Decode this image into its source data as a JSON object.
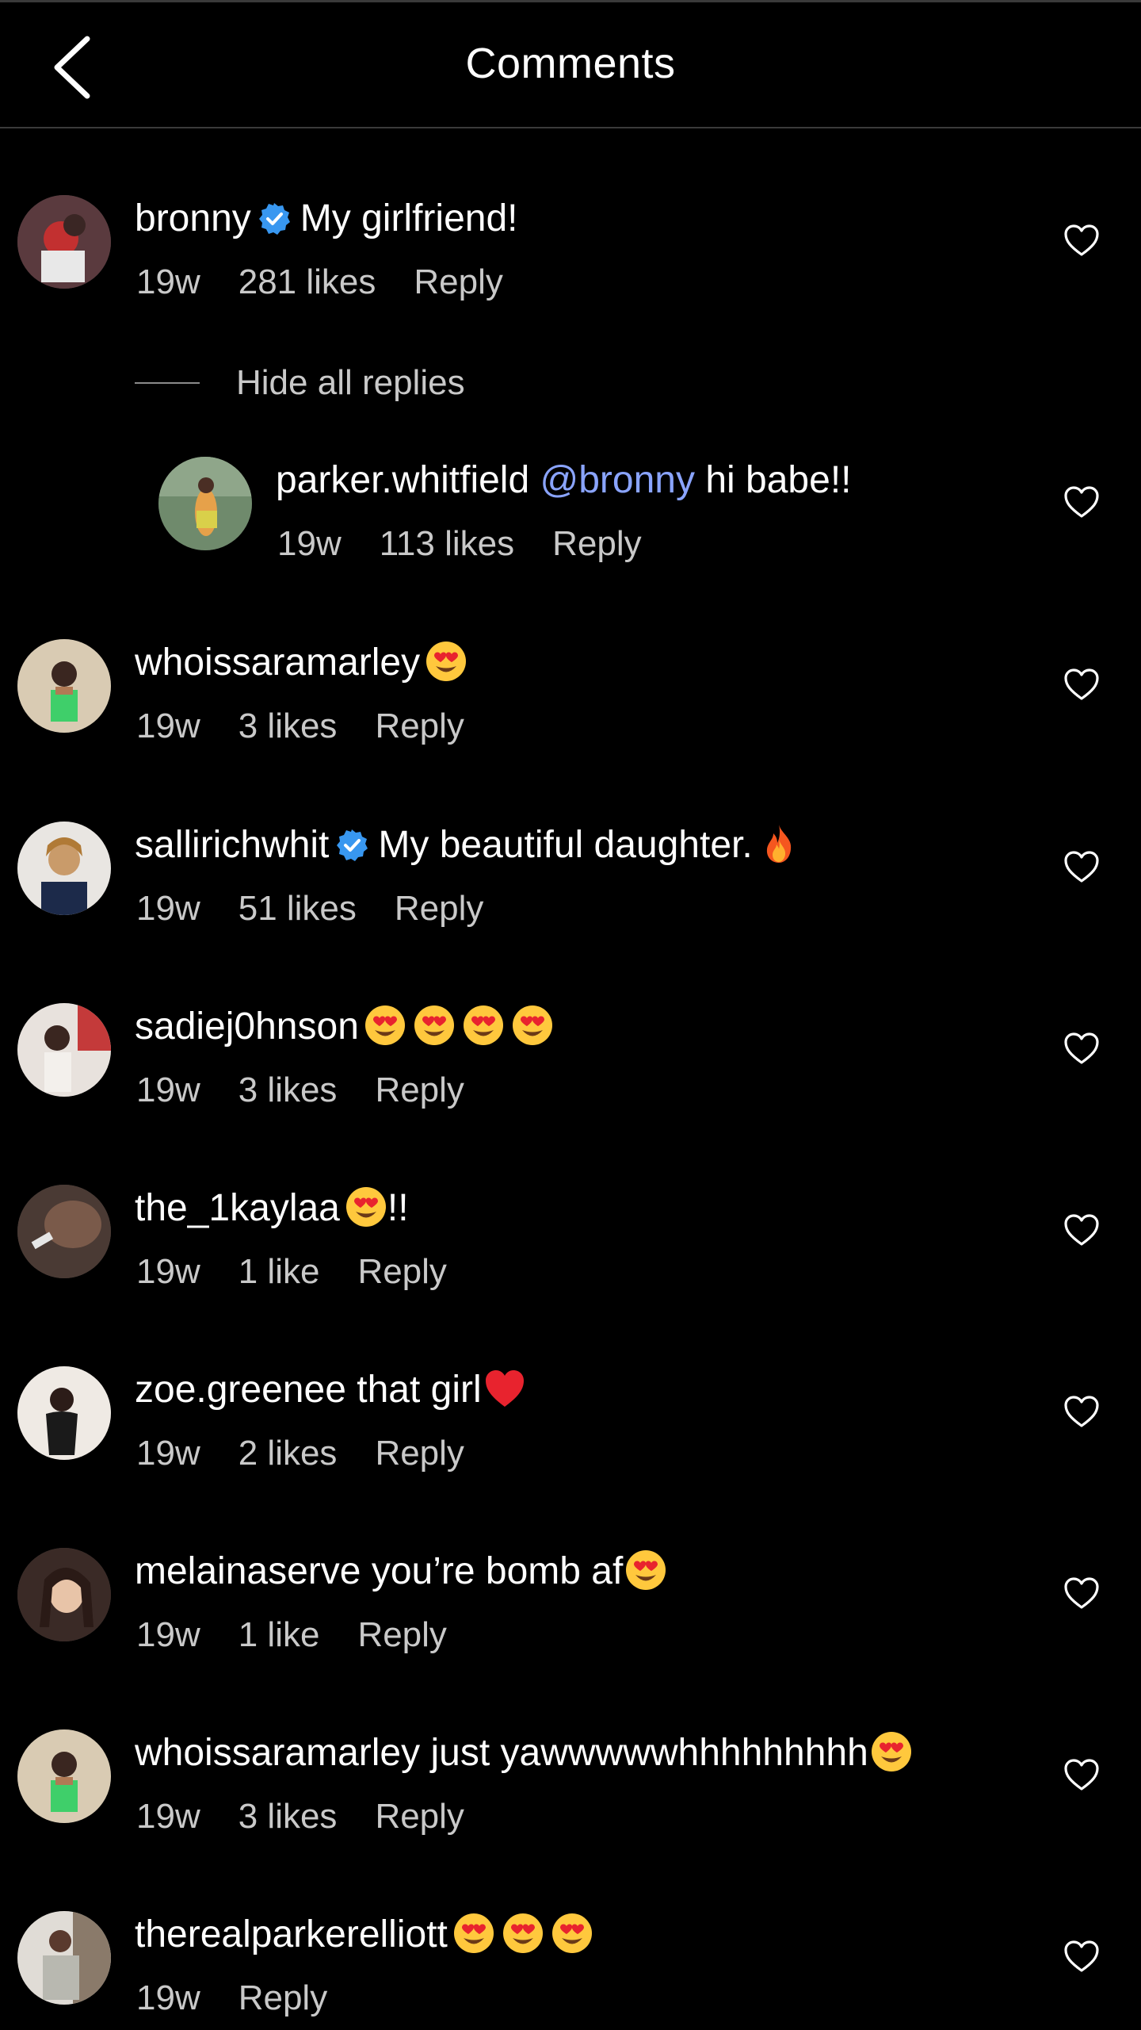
{
  "header": {
    "title": "Comments"
  },
  "colors": {
    "background": "#000000",
    "mention": "#8aa4ff",
    "verified": "#3897f0",
    "meta_text": "#c9c9c9"
  },
  "thread": {
    "hide_replies_label": "Hide all replies"
  },
  "comments": [
    {
      "username": "bronny",
      "verified": true,
      "text": "My girlfriend!",
      "time": "19w",
      "likes": "281 likes",
      "reply": "Reply",
      "emojis": []
    },
    {
      "username": "parker.whitfield",
      "mention": "@bronny",
      "text": "hi babe!!",
      "time": "19w",
      "likes": "113 likes",
      "reply": "Reply",
      "is_reply": true
    },
    {
      "username": "whoissaramarley",
      "text": "",
      "emojis": [
        "heart-eyes-emoji"
      ],
      "time": "19w",
      "likes": "3 likes",
      "reply": "Reply"
    },
    {
      "username": "sallirichwhit",
      "verified": true,
      "text": "My beautiful daughter.",
      "emojis": [
        "fire-emoji"
      ],
      "time": "19w",
      "likes": "51 likes",
      "reply": "Reply"
    },
    {
      "username": "sadiej0hnson",
      "text": "",
      "emojis": [
        "heart-eyes-emoji",
        "heart-eyes-emoji",
        "heart-eyes-emoji",
        "heart-eyes-emoji"
      ],
      "time": "19w",
      "likes": "3 likes",
      "reply": "Reply"
    },
    {
      "username": "the_1kaylaa",
      "text_after_emoji": "!!",
      "emojis": [
        "heart-eyes-emoji"
      ],
      "time": "19w",
      "likes": "1 like",
      "reply": "Reply"
    },
    {
      "username": "zoe.greenee",
      "text": "that girl",
      "emojis": [
        "red-heart-emoji"
      ],
      "time": "19w",
      "likes": "2 likes",
      "reply": "Reply"
    },
    {
      "username": "melainaserve",
      "text": "you’re bomb af",
      "emojis": [
        "heart-eyes-emoji"
      ],
      "time": "19w",
      "likes": "1 like",
      "reply": "Reply"
    },
    {
      "username": "whoissaramarley",
      "text": "just yawwwwwhhhhhhhhh",
      "emojis": [
        "heart-eyes-emoji"
      ],
      "time": "19w",
      "likes": "3 likes",
      "reply": "Reply"
    },
    {
      "username": "therealparkerelliott",
      "text": "",
      "emojis": [
        "heart-eyes-emoji",
        "heart-eyes-emoji",
        "heart-eyes-emoji"
      ],
      "time": "19w",
      "reply": "Reply"
    }
  ]
}
